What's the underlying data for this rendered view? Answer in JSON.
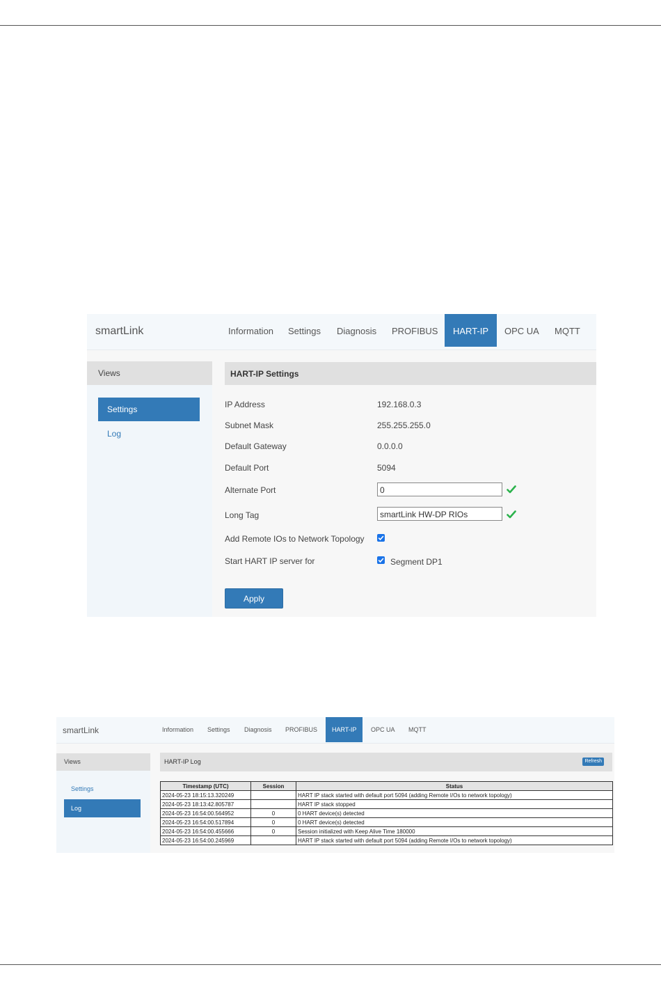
{
  "panel1": {
    "brand": "smartLink",
    "nav": [
      "Information",
      "Settings",
      "Diagnosis",
      "PROFIBUS",
      "HART-IP",
      "OPC UA",
      "MQTT"
    ],
    "active_nav": "HART-IP",
    "views_title": "Views",
    "side_items": {
      "settings": "Settings",
      "log": "Log"
    },
    "section_title": "HART-IP Settings",
    "fields": {
      "ip_label": "IP Address",
      "ip_value": "192.168.0.3",
      "mask_label": "Subnet Mask",
      "mask_value": "255.255.255.0",
      "gateway_label": "Default Gateway",
      "gateway_value": "0.0.0.0",
      "port_label": "Default Port",
      "port_value": "5094",
      "alt_port_label": "Alternate Port",
      "alt_port_value": "0",
      "long_tag_label": "Long Tag",
      "long_tag_value": "smartLink HW-DP RIOs",
      "add_remote_label": "Add Remote IOs to Network Topology",
      "add_remote_checked": true,
      "start_server_label": "Start HART IP server for",
      "segment_label": "Segment DP1",
      "segment_checked": true
    },
    "apply_label": "Apply",
    "colors": {
      "accent": "#337ab7",
      "valid": "#2bb24c"
    }
  },
  "panel2": {
    "brand": "smartLink",
    "nav": [
      "Information",
      "Settings",
      "Diagnosis",
      "PROFIBUS",
      "HART-IP",
      "OPC UA",
      "MQTT"
    ],
    "active_nav": "HART-IP",
    "views_title": "Views",
    "side_items": {
      "settings": "Settings",
      "log": "Log"
    },
    "section_title": "HART-IP Log",
    "refresh_label": "Refresh",
    "table": {
      "headers": [
        "Timestamp (UTC)",
        "Session",
        "Status"
      ],
      "rows": [
        [
          "2024-05-23 18:15:13.320249",
          "",
          "HART IP stack started with default port 5094 (adding Remote I/Os to network topology)"
        ],
        [
          "2024-05-23 18:13:42.805787",
          "",
          "HART IP stack stopped"
        ],
        [
          "2024-05-23 16:54:00.564952",
          "0",
          "0 HART device(s) detected"
        ],
        [
          "2024-05-23 16:54:00.517894",
          "0",
          "0 HART device(s) detected"
        ],
        [
          "2024-05-23 16:54:00.455666",
          "0",
          "Session initialized with Keep Alive Time 180000"
        ],
        [
          "2024-05-23 16:54:00.245969",
          "",
          "HART IP stack started with default port 5094 (adding Remote I/Os to network topology)"
        ]
      ]
    }
  }
}
